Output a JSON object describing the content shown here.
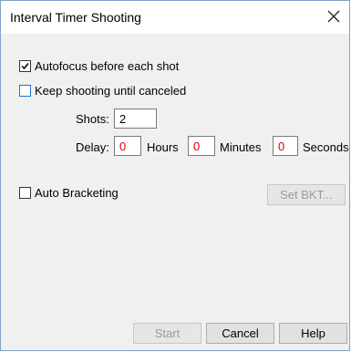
{
  "window": {
    "title": "Interval Timer Shooting"
  },
  "options": {
    "autofocus": {
      "label": "Autofocus before each shot",
      "checked": true
    },
    "keep_shooting": {
      "label": "Keep shooting until canceled",
      "checked": false
    },
    "auto_bracketing": {
      "label": "Auto Bracketing",
      "checked": false
    }
  },
  "shots": {
    "label": "Shots:",
    "value": "2"
  },
  "delay": {
    "label": "Delay:",
    "hours_value": "0",
    "hours_label": "Hours",
    "minutes_value": "0",
    "minutes_label": "Minutes",
    "seconds_value": "0",
    "seconds_label": "Seconds",
    "value_color": "#e00000"
  },
  "buttons": {
    "set_bkt": "Set BKT...",
    "start": "Start",
    "cancel": "Cancel",
    "help": "Help"
  }
}
